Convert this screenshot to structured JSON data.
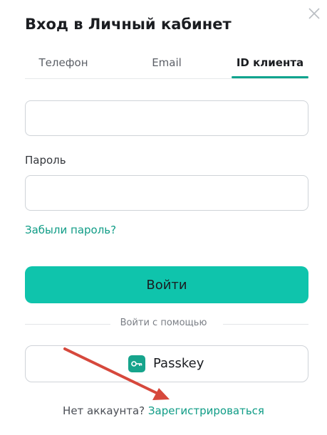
{
  "modal": {
    "title": "Вход в Личный кабинет"
  },
  "tabs": [
    {
      "label": "Телефон",
      "active": false
    },
    {
      "label": "Email",
      "active": false
    },
    {
      "label": "ID клиента",
      "active": true
    }
  ],
  "form": {
    "client_id_value": "",
    "password_label": "Пароль",
    "password_value": "",
    "forgot_link": "Забыли пароль?",
    "login_button": "Войти",
    "divider_text": "Войти с помощью",
    "passkey_button": "Passkey"
  },
  "footer": {
    "no_account_text": "Нет аккаунта?",
    "register_link": "Зарегистрироваться"
  },
  "colors": {
    "accent": "#0fc4ac",
    "link": "#0f9c86",
    "arrow": "#d6483c"
  },
  "icons": {
    "close": "close-icon",
    "passkey": "key-icon"
  }
}
